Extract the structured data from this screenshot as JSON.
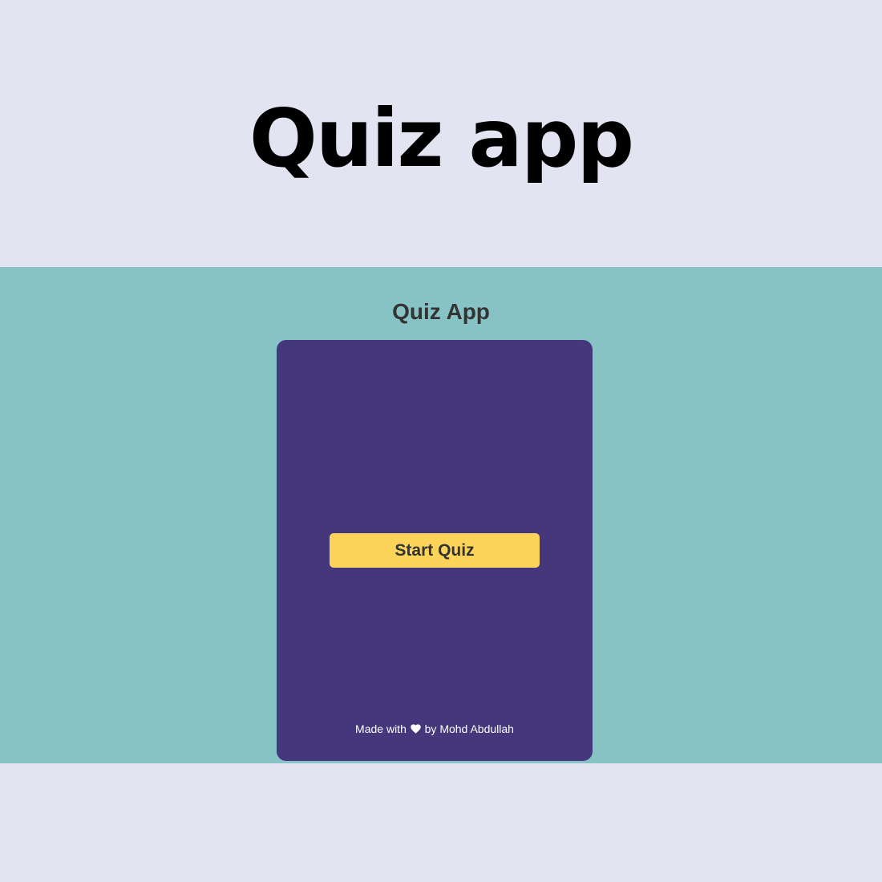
{
  "hero": {
    "title": "Quiz app"
  },
  "app": {
    "heading": "Quiz App",
    "start_button_label": "Start Quiz",
    "footer": {
      "prefix": "Made with",
      "icon": "heart-icon",
      "suffix": "by Mohd Abdullah"
    }
  },
  "colors": {
    "page_background": "#e2e4f2",
    "stage_background": "#87c3c4",
    "card_background": "#44377c",
    "button_background": "#fcd45a",
    "heading_text": "#333333"
  }
}
